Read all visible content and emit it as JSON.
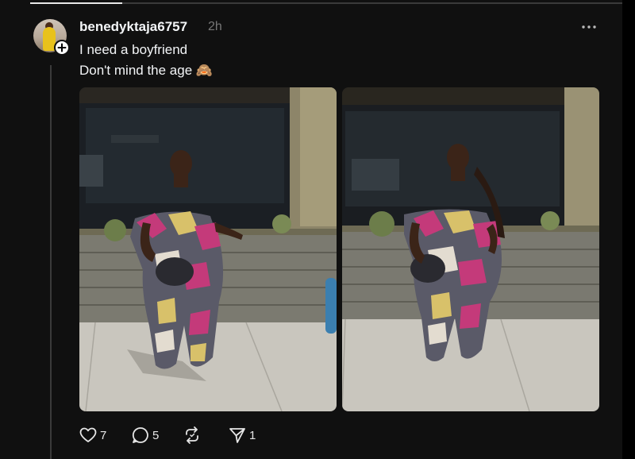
{
  "post": {
    "username": "benedyktaja6757",
    "timestamp": "2h",
    "text_lines": [
      "I need a boyfriend",
      "Don't mind the age 🙈"
    ],
    "images": [
      {
        "icon": "photo-woman-geometric-jumpsuit"
      },
      {
        "icon": "photo-woman-geometric-jumpsuit"
      }
    ]
  },
  "actions": {
    "like": {
      "icon": "heart-icon",
      "count": "7"
    },
    "comment": {
      "icon": "comment-icon",
      "count": "5"
    },
    "repost": {
      "icon": "repost-icon",
      "count": ""
    },
    "share": {
      "icon": "send-icon",
      "count": "1"
    }
  },
  "colors": {
    "background": "#101010",
    "text_primary": "#f3f5f7",
    "text_secondary": "#777777",
    "divider": "#3a3a3a"
  }
}
